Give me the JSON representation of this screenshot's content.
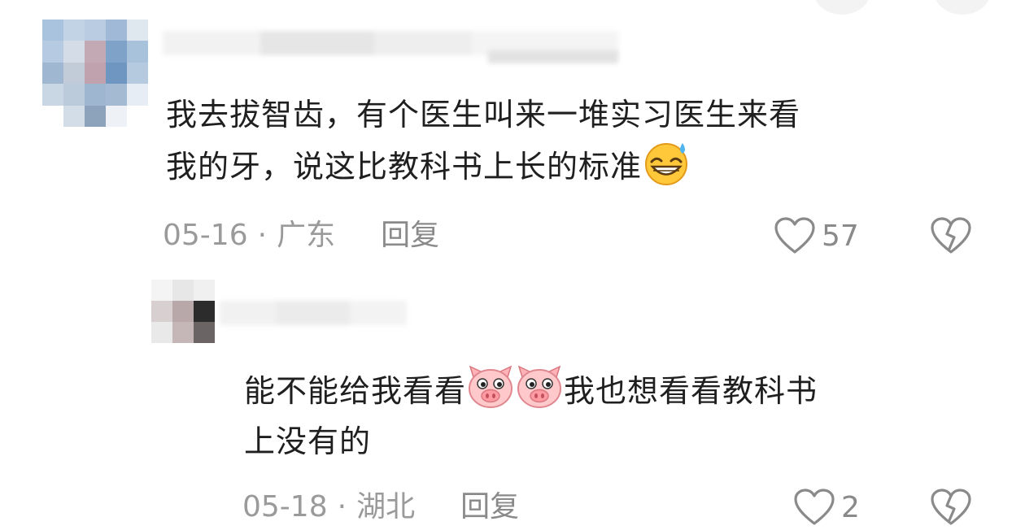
{
  "comment1": {
    "text_line1": "我去拔智齿，有个医生叫来一堆实习医生来看",
    "text_line2": "我的牙，说这比教科书上长的标准",
    "emoji": "grinning-sweat-emoji",
    "date": "05-16",
    "separator": "·",
    "region": "广东",
    "reply_label": "回复",
    "like_count": "57"
  },
  "comment2": {
    "text_line1_a": "能不能给我看看",
    "text_line1_b": "我也想看看教科书",
    "text_line2": "上没有的",
    "emoji": "pig-face-emoji",
    "date": "05-18",
    "separator": "·",
    "region": "湖北",
    "reply_label": "回复",
    "like_count": "2"
  },
  "icons": {
    "like": "heart-outline-icon",
    "dislike": "broken-heart-icon"
  },
  "colors": {
    "text": "#1f1f1f",
    "meta": "#9a9a9a",
    "icon": "#8a8a8a"
  }
}
